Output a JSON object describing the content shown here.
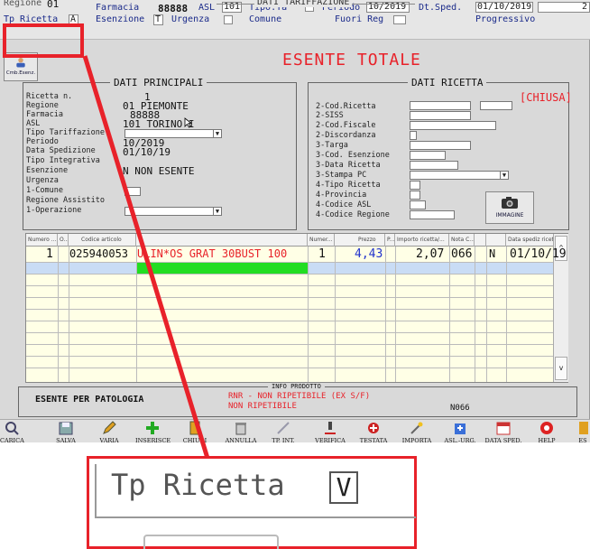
{
  "header": {
    "regione_label": "Regione",
    "regione_val": "01",
    "farmacia_label": "Farmacia",
    "farmacia_val": "88888",
    "asl_label": "ASL",
    "asl_val": "101",
    "tipo_ta_label": "Tipo.Ta",
    "periodo_label": "Periodo",
    "periodo_val": "10/2019",
    "dtsped_label": "Dt.Sped.",
    "dtsped_val": "01/10/2019",
    "extra_val": "2",
    "section_title": "DATI TARIFFAZIONE",
    "tpricetta_label": "Tp Ricetta",
    "tpricetta_val": "A",
    "esenzione_label": "Esenzione",
    "esenzione_val": "T",
    "urgenza_label": "Urgenza",
    "comune_label": "Comune",
    "fuorireg_label": "Fuori Reg",
    "progressivo_label": "Progressivo"
  },
  "cmb_label": "Cmb.Esenz.",
  "esente_title": "ESENTE TOTALE",
  "principali": {
    "title": "DATI PRINCIPALI",
    "rows": [
      {
        "label": "Ricetta n.",
        "value": "1"
      },
      {
        "label": "Regione",
        "value": "01  PIEMONTE"
      },
      {
        "label": "Farmacia",
        "value": "88888"
      },
      {
        "label": "ASL",
        "value": "101_TORINO I"
      },
      {
        "label": "Tipo Tariffazione",
        "value": ""
      },
      {
        "label": "Periodo",
        "value": "10/2019"
      },
      {
        "label": "Data Spedizione",
        "value": "01/10/19"
      },
      {
        "label": "Tipo Integrativa",
        "value": ""
      },
      {
        "label": "Esenzione",
        "value": "N   NON ESENTE"
      },
      {
        "label": "Urgenza",
        "value": ""
      },
      {
        "label": "1-Comune",
        "value": ""
      },
      {
        "label": "Regione Assistito",
        "value": ""
      },
      {
        "label": "1-Operazione",
        "value": ""
      }
    ]
  },
  "ricetta": {
    "title": "DATI RICETTA",
    "status": "[CHIUSA]",
    "rows": [
      "2-Cod.Ricetta",
      "2-SISS",
      "2-Cod.Fiscale",
      "2-Discordanza",
      "3-Targa",
      "3-Cod. Esenzione",
      "3-Data Ricetta",
      "3-Stampa PC",
      "4-Tipo Ricetta",
      "4-Provincia",
      "4-Codice ASL",
      "4-Codice Regione"
    ],
    "immagine_label": "IMMAGINE"
  },
  "grid": {
    "headers": [
      "Numero ...",
      "O...",
      "Codice articolo",
      "",
      "Numer...",
      "Prezzo",
      "P...",
      "Importo ricetta/...",
      "Nota C...",
      "",
      "",
      "Data spediz ricetta"
    ],
    "row": {
      "numero": "1",
      "codice": "025940053",
      "descr": "ULIN*OS GRAT 30BUST 100",
      "num": "1",
      "prezzo": "4,43",
      "importo": "2,07",
      "nota": "066",
      "flag": "N",
      "data": "01/10/19"
    }
  },
  "info": {
    "title": "INFO PRODOTTO",
    "left": "ESENTE PER PATOLOGIA",
    "line1": "RNR - NON RIPETIBILE (EX S/F)",
    "line2": "NON RIPETIBILE",
    "code": "N066"
  },
  "toolbar": [
    "CARICA",
    "SALVA",
    "VARIA",
    "INSERISCE",
    "CHIUDI",
    "ANNULLA",
    "TP. INT.",
    "VERIFICA",
    "TESTATA",
    "IMPORTA",
    "ASL.-URG.",
    "DATA SPED.",
    "HELP",
    "ES"
  ],
  "zoom": {
    "label": "Tp Ricetta",
    "value": "V"
  },
  "colors": {
    "highlight": "#e8222a",
    "esente": "#e8222a",
    "grid_bg": "#ffffe6",
    "selected_row": "#c9dcf5",
    "green": "#22dd22"
  }
}
